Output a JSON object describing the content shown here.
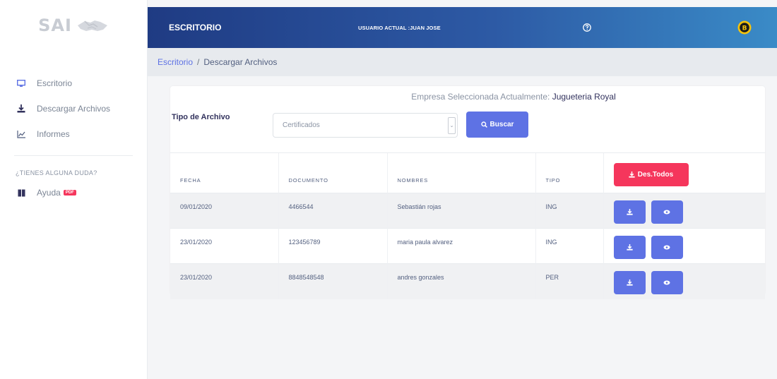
{
  "brand": {
    "text": "SAI"
  },
  "sidebar": {
    "items": [
      {
        "label": "Escritorio",
        "icon": "desktop-icon"
      },
      {
        "label": "Descargar Archivos",
        "icon": "download-icon"
      },
      {
        "label": "Informes",
        "icon": "chart-line-icon"
      }
    ],
    "heading": "¿TIENES ALGUNA DUDA?",
    "help": {
      "label": "Ayuda",
      "badge": "PDF",
      "icon": "book-icon"
    }
  },
  "topbar": {
    "title": "ESCRITORIO",
    "user": "USUARIO ACTUAL :JUAN JOSE",
    "gradient_start": "#1f3b83",
    "gradient_end": "#3a8bc7"
  },
  "breadcrumb": {
    "home": "Escritorio",
    "current": "Descargar Archivos"
  },
  "card": {
    "company_prefix": "Empresa Seleccionada Actualmente:",
    "company_name": "Jugueteria Royal",
    "type_label": "Tipo de Archivo",
    "select_value": "Certificados",
    "search_button": "Buscar",
    "download_all_button": "Des.Todos"
  },
  "table": {
    "columns": [
      "FECHA",
      "DOCUMENTO",
      "NOMBRES",
      "TIPO"
    ],
    "rows": [
      {
        "fecha": "09/01/2020",
        "documento": "4466544",
        "nombres": "Sebastián rojas",
        "tipo": "ING"
      },
      {
        "fecha": "23/01/2020",
        "documento": "123456789",
        "nombres": "maria paula alvarez",
        "tipo": "ING"
      },
      {
        "fecha": "23/01/2020",
        "documento": "8848548548",
        "nombres": "andres gonzales",
        "tipo": "PER"
      }
    ]
  },
  "colors": {
    "primary": "#5e72e4",
    "danger": "#f5365c",
    "link": "#5e72e4"
  }
}
